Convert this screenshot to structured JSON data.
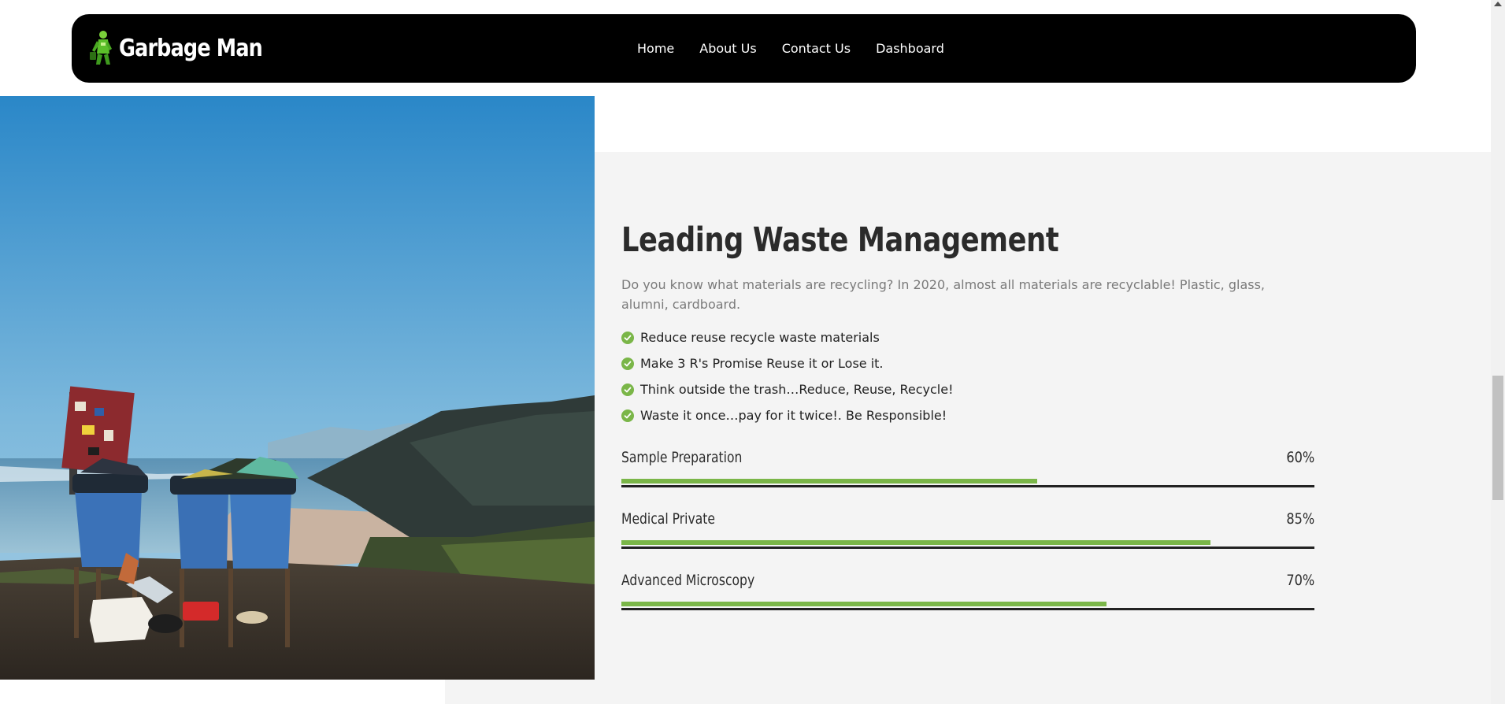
{
  "navbar": {
    "brand_name": "Garbage Man",
    "logo_icon": "garbage-man-mascot-icon",
    "links": [
      {
        "label": "Home"
      },
      {
        "label": "About Us"
      },
      {
        "label": "Contact Us"
      },
      {
        "label": "Dashboard"
      }
    ]
  },
  "hero_image": {
    "icon": "photo-blue-recycling-bins-on-coastal-cliff"
  },
  "main": {
    "title": "Leading Waste Management",
    "intro": "Do you know what materials are recycling? In 2020, almost all materials are recyclable! Plastic, glass, alumni, cardboard.",
    "features": [
      {
        "text": "Reduce reuse recycle waste materials",
        "icon": "check-circle-icon"
      },
      {
        "text": "Make 3 R's Promise Reuse it or Lose it.",
        "icon": "check-circle-icon"
      },
      {
        "text": "Think outside the trash…Reduce, Reuse, Recycle!",
        "icon": "check-circle-icon"
      },
      {
        "text": "Waste it once…pay for it twice!. Be Responsible!",
        "icon": "check-circle-icon"
      }
    ],
    "skills": [
      {
        "name": "Sample Preparation",
        "percent_label": "60%",
        "value": 60
      },
      {
        "name": "Medical Private",
        "percent_label": "85%",
        "value": 85
      },
      {
        "name": "Advanced Microscopy",
        "percent_label": "70%",
        "value": 70
      }
    ]
  },
  "colors": {
    "accent_green": "#7ab648",
    "navbar_bg": "#000000",
    "section_bg": "#f4f4f4",
    "heading_text": "#2b2b2b",
    "muted_text": "#7a7a7a"
  }
}
